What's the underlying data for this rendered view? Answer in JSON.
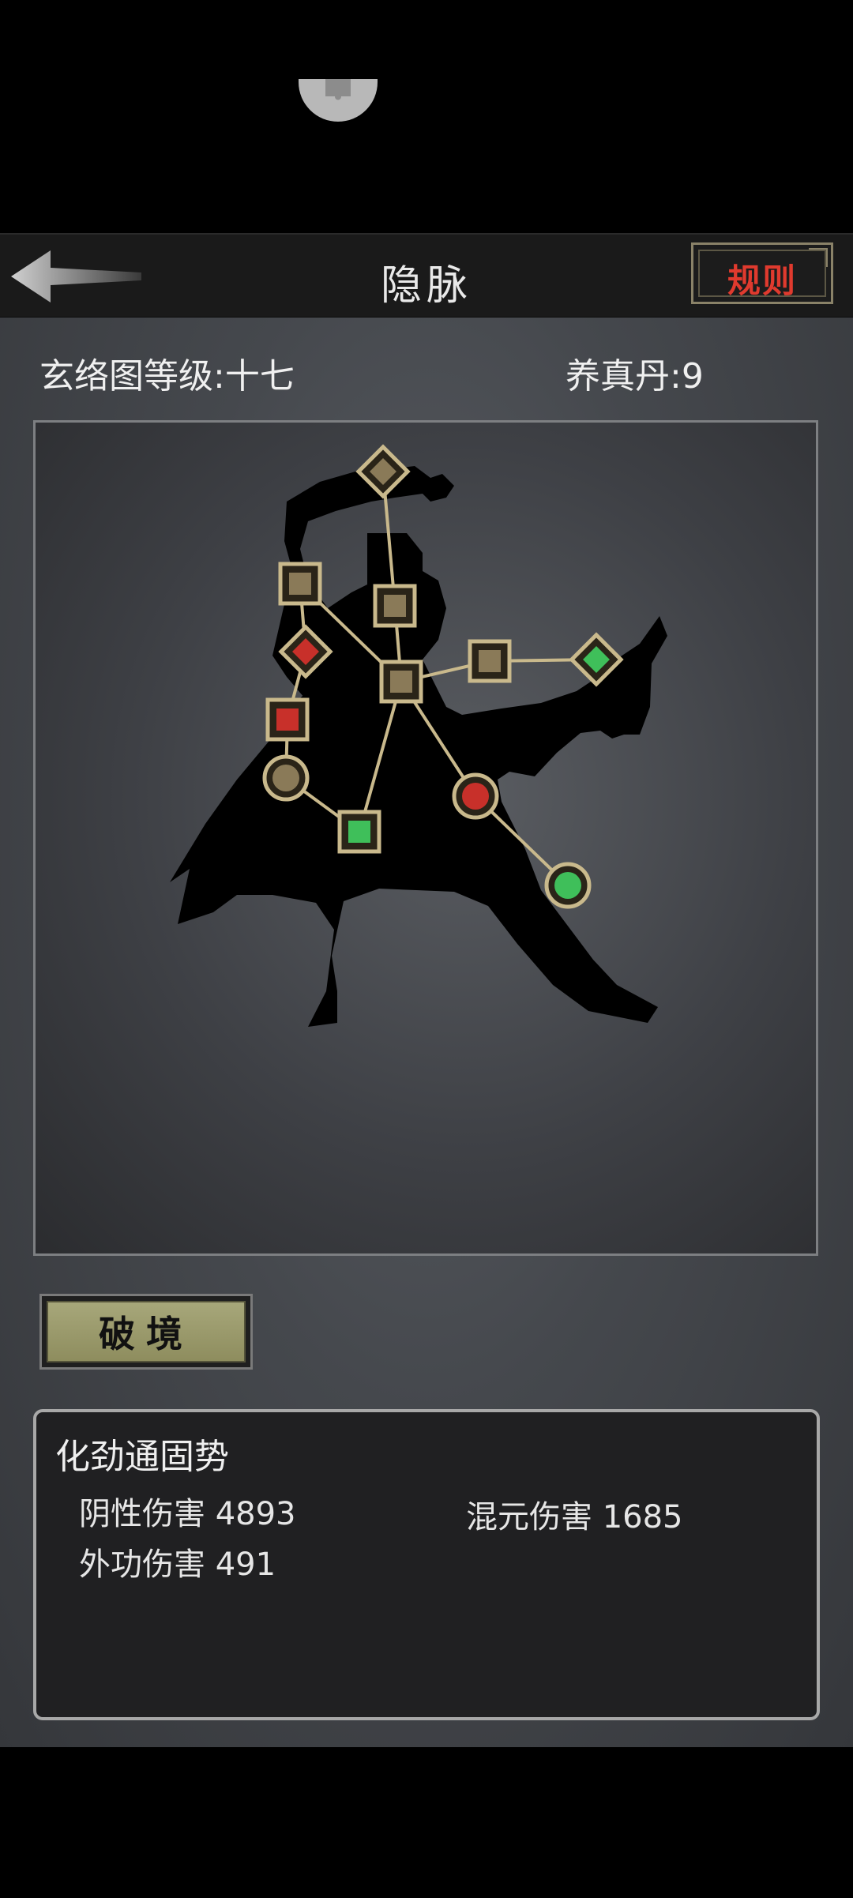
{
  "header": {
    "title": "隐脉",
    "rules_label": "规则",
    "back_icon": "back-arrow-icon"
  },
  "stats": {
    "level": "玄络图等级:十七",
    "pill": "养真丹:9"
  },
  "meridian_map": {
    "nodes": [
      {
        "id": "head",
        "shape": "diamond",
        "color": "#8a7a58"
      },
      {
        "id": "left-shoulder",
        "shape": "square",
        "color": "#8a7a58"
      },
      {
        "id": "neck",
        "shape": "square",
        "color": "#8a7a58"
      },
      {
        "id": "left-arm",
        "shape": "diamond",
        "color": "#c8302a"
      },
      {
        "id": "center",
        "shape": "square",
        "color": "#8a7a58"
      },
      {
        "id": "right-elbow",
        "shape": "square",
        "color": "#8a7a58"
      },
      {
        "id": "right-hand",
        "shape": "diamond",
        "color": "#3fbf5a"
      },
      {
        "id": "left-hip",
        "shape": "square",
        "color": "#c8302a"
      },
      {
        "id": "left-knee",
        "shape": "circle",
        "color": "#8a7a58"
      },
      {
        "id": "left-foot",
        "shape": "square",
        "color": "#3fbf5a"
      },
      {
        "id": "right-knee",
        "shape": "circle",
        "color": "#c8302a"
      },
      {
        "id": "right-foot",
        "shape": "circle",
        "color": "#3fbf5a"
      }
    ]
  },
  "breakthrough": {
    "label": "破境"
  },
  "info": {
    "title": "化劲通固势",
    "stat1": "阴性伤害 4893",
    "stat2": "混元伤害 1685",
    "stat3": "外功伤害 491"
  },
  "colors": {
    "accent_red": "#e03a2e",
    "button_olive": "#a7a77a",
    "node_gold": "#8a7a58",
    "node_red": "#c8302a",
    "node_green": "#3fbf5a"
  }
}
